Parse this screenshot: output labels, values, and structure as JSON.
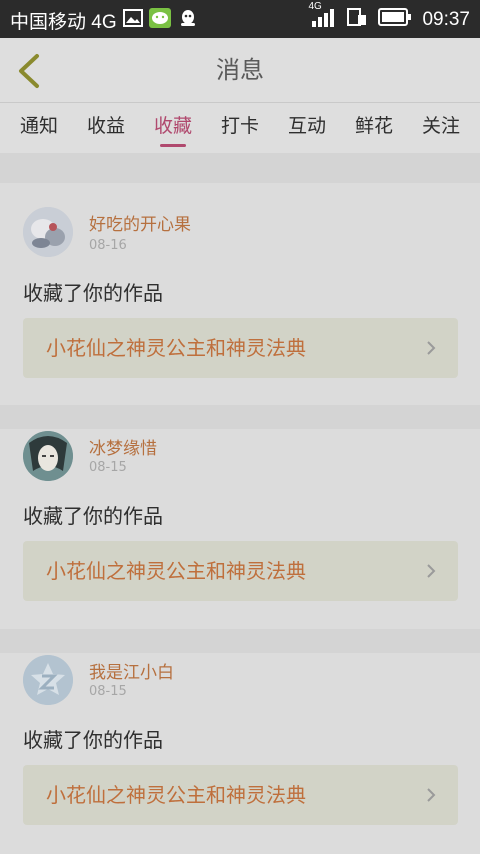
{
  "status_bar": {
    "carrier": "中国移动 4G",
    "network_badge": "4G",
    "time": "09:37",
    "icons": [
      "gallery-icon",
      "wechat-icon",
      "qq-icon",
      "signal-icon",
      "sim-icon",
      "battery-icon"
    ]
  },
  "header": {
    "title": "消息",
    "back_icon": "back-chevron-icon"
  },
  "tabs": [
    {
      "label": "通知"
    },
    {
      "label": "收益"
    },
    {
      "label": "收藏",
      "active": true
    },
    {
      "label": "打卡"
    },
    {
      "label": "互动"
    },
    {
      "label": "鲜花"
    },
    {
      "label": "关注"
    }
  ],
  "colors": {
    "accent": "#b0496e",
    "username": "#b6703f",
    "work_title": "#bf6f3c"
  },
  "messages": [
    {
      "user": "好吃的开心果",
      "date": "08-16",
      "action": "收藏了你的作品",
      "work": "小花仙之神灵公主和神灵法典"
    },
    {
      "user": "冰梦缘惜",
      "date": "08-15",
      "action": "收藏了你的作品",
      "work": "小花仙之神灵公主和神灵法典"
    },
    {
      "user": "我是江小白",
      "date": "08-15",
      "action": "收藏了你的作品",
      "work": "小花仙之神灵公主和神灵法典"
    }
  ]
}
